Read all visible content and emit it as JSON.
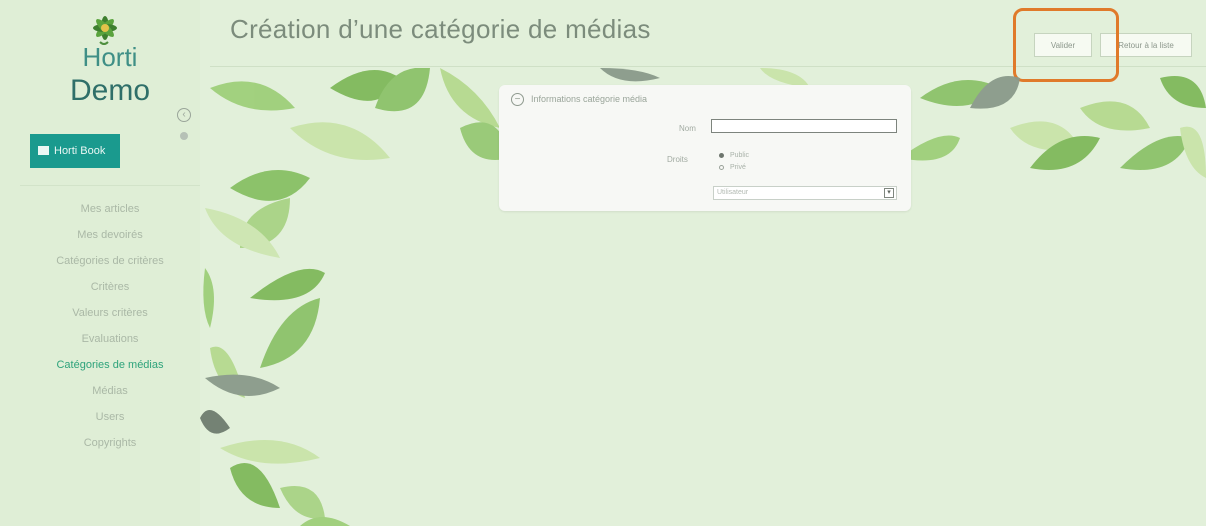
{
  "page": {
    "title": "Création d’une catégorie de médias"
  },
  "logo": {
    "line1": "Horti",
    "line2": "Demo"
  },
  "sidebar": {
    "toggle_icon": "circle-collapse-icon",
    "app_button": {
      "label": "Horti Book",
      "icon": "book-icon"
    },
    "items": [
      {
        "label": "Mes articles",
        "active": false
      },
      {
        "label": "Mes devoirés",
        "active": false
      },
      {
        "label": "Catégories de critères",
        "active": false
      },
      {
        "label": "Critères",
        "active": false
      },
      {
        "label": "Valeurs critères",
        "active": false
      },
      {
        "label": "Evaluations",
        "active": false
      },
      {
        "label": "Catégories de médias",
        "active": true
      },
      {
        "label": "Médias",
        "active": false
      },
      {
        "label": "Users",
        "active": false
      },
      {
        "label": "Copyrights",
        "active": false
      }
    ]
  },
  "toolbar": {
    "validate_label": "Valider",
    "return_label": "Retour à la liste"
  },
  "form": {
    "section_title": "Informations catégorie média",
    "nom_label": "Nom",
    "nom_value": "",
    "droits_label": "Droits",
    "radio_public": "Public",
    "radio_prive": "Privé",
    "select_value": "Utilisateur"
  },
  "colors": {
    "accent": "#1a9a8e",
    "active_nav": "#2ea37b",
    "highlight": "#e07a2a",
    "background": "#e2f0da"
  }
}
